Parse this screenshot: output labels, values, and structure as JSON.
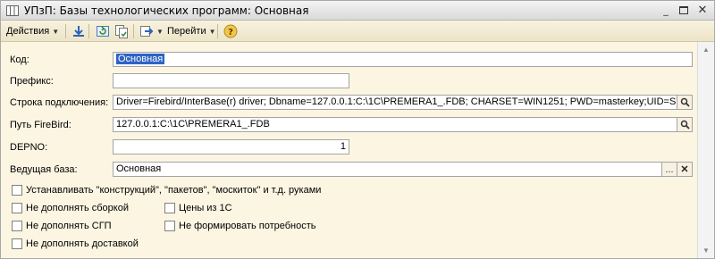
{
  "window": {
    "title": "УПзП: Базы технологических программ: Основная"
  },
  "toolbar": {
    "actions_label": "Действия",
    "goto_label": "Перейти"
  },
  "form": {
    "code": {
      "label": "Код:",
      "value": "Основная"
    },
    "prefix": {
      "label": "Префикс:",
      "value": ""
    },
    "conn": {
      "label": "Строка подключения:",
      "value": "Driver=Firebird/InterBase(r) driver; Dbname=127.0.0.1:C:\\1C\\PREMERA1_.FDB; CHARSET=WIN1251; PWD=masterkey;UID=SYSDBA"
    },
    "path": {
      "label": "Путь FireBird:",
      "value": "127.0.0.1:C:\\1C\\PREMERA1_.FDB"
    },
    "depno": {
      "label": "DEPNO:",
      "value": "1"
    },
    "lead": {
      "label": "Ведущая база:",
      "value": "Основная"
    }
  },
  "checkboxes": {
    "manual": {
      "label": "Устанавливать \"конструкций\", \"пакетов\", \"москиток\" и т.д. руками",
      "checked": false
    },
    "no_assembly": {
      "label": "Не дополнять сборкой",
      "checked": false
    },
    "prices_1c": {
      "label": "Цены из 1С",
      "checked": false
    },
    "no_sgp": {
      "label": "Не дополнять СГП",
      "checked": false
    },
    "no_demand": {
      "label": "Не формировать потребность",
      "checked": false
    },
    "no_delivery": {
      "label": "Не дополнять доставкой",
      "checked": false
    }
  },
  "icons": {
    "lookup": "magnifier-icon",
    "clear": "close-icon",
    "select": "ellipsis"
  }
}
